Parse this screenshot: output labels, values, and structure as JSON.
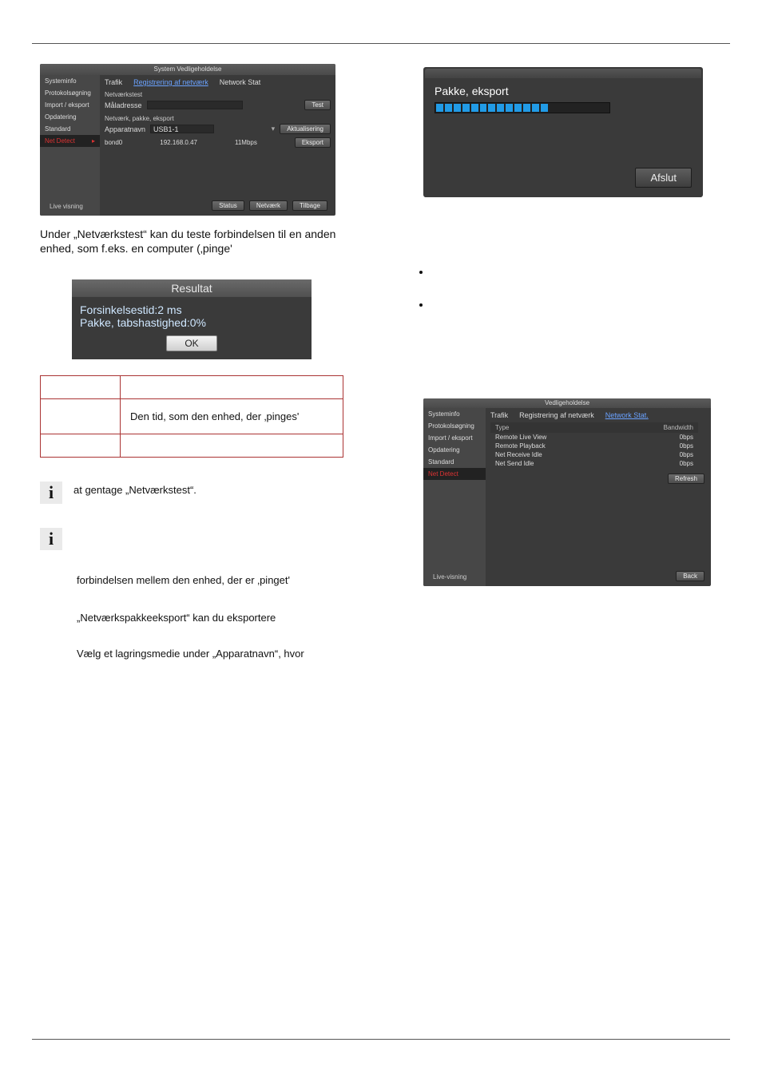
{
  "panel1": {
    "title": "System Vedligeholdelse",
    "sidebar": [
      "Systeminfo",
      "Protokolsøgning",
      "Import / eksport",
      "Opdatering",
      "Standard",
      "Net Detect",
      "Live visning"
    ],
    "tabs": [
      "Trafik",
      "Registrering af netværk",
      "Network Stat"
    ],
    "section1": "Netværkstest",
    "label_ip": "Måladresse",
    "btn_test": "Test",
    "section2": "Netværk, pakke, eksport",
    "label_device": "Apparatnavn",
    "device_value": "USB1-1",
    "btn_akt": "Aktualisering",
    "row_name": "bond0",
    "row_ip": "192.168.0.47",
    "row_speed": "11Mbps",
    "btn_eksport": "Eksport",
    "footer": [
      "Status",
      "Netværk",
      "Tilbage"
    ]
  },
  "text_under_panel1": "Under „Netværkstest“ kan du teste forbindelsen til en anden enhed, som f.eks. en computer (‚pinge'",
  "resultat": {
    "title": "Resultat",
    "line1": "Forsinkelsestid:2 ms",
    "line2": "Pakke, tabshastighed:0%",
    "ok": "OK"
  },
  "def_table": {
    "c1r1": "",
    "c2r1": "",
    "c1r2": "",
    "c2r2": "Den tid, som den enhed, der ‚pinges'",
    "c1r3": "",
    "c2r3": ""
  },
  "info_notes": [
    "at gentage „Netværkstest“.",
    "forbindelsen mellem den enhed, der er ‚pinget'"
  ],
  "plain_lines": [
    "„Netværkspakkeeksport“ kan du eksportere",
    "Vælg et lagringsmedie under „Apparatnavn“, hvor"
  ],
  "pakke": {
    "title": "Pakke, eksport",
    "btn": "Afslut"
  },
  "bullets": [
    "",
    ""
  ],
  "panel3": {
    "title": "Vedligeholdelse",
    "sidebar": [
      "Systeminfo",
      "Protokolsøgning",
      "Import / eksport",
      "Opdatering",
      "Standard",
      "Net Detect",
      "Live-visning"
    ],
    "tabs": [
      "Trafik",
      "Registrering af netværk",
      "Network Stat."
    ],
    "col_type": "Type",
    "col_bw": "Bandwidth",
    "rows": [
      {
        "t": "Remote Live View",
        "b": "0bps"
      },
      {
        "t": "Remote Playback",
        "b": "0bps"
      },
      {
        "t": "Net Receive Idle",
        "b": "0bps"
      },
      {
        "t": "Net Send Idle",
        "b": "0bps"
      }
    ],
    "btn_refresh": "Refresh",
    "btn_back": "Back"
  }
}
